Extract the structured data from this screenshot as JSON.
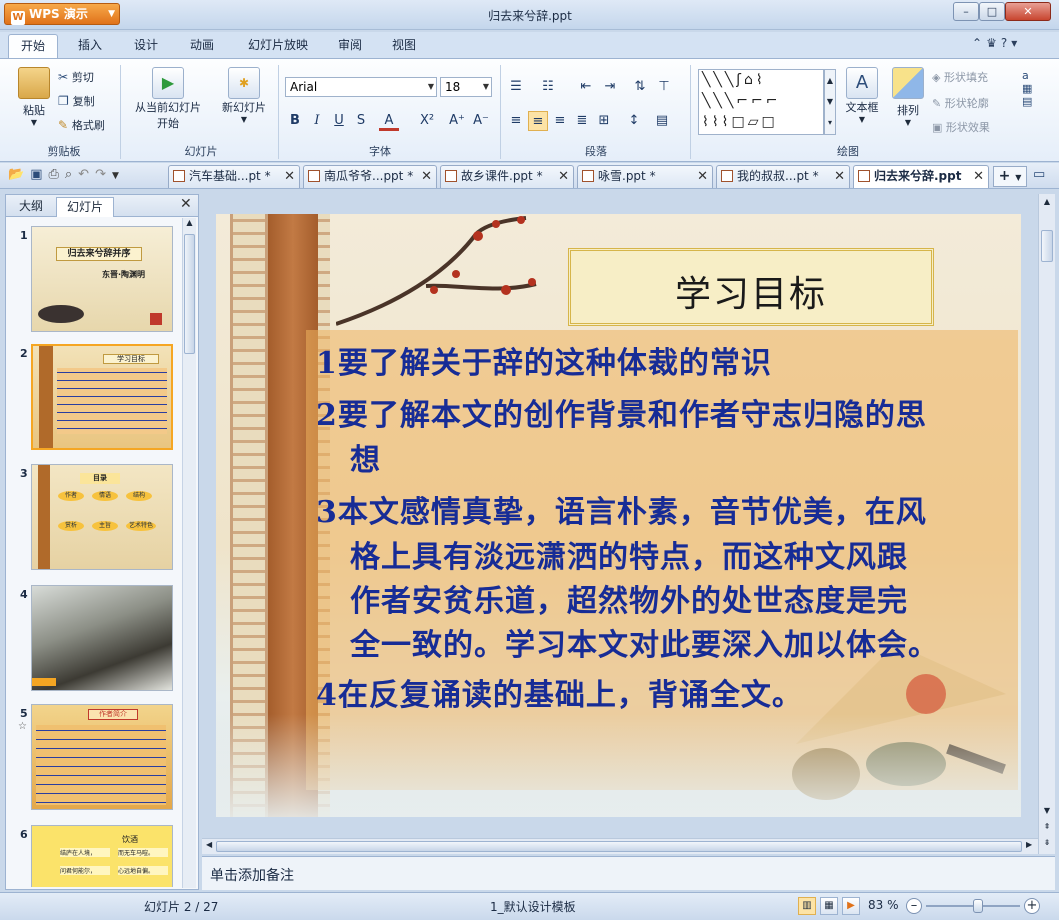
{
  "app": {
    "name": "WPS 演示",
    "window_title": "归去来兮辞.ppt"
  },
  "window_controls": {
    "minimize": "–",
    "maximize": "□",
    "close": "✕"
  },
  "menu": {
    "tabs": [
      "开始",
      "插入",
      "设计",
      "动画",
      "幻灯片放映",
      "审阅",
      "视图"
    ],
    "active": "开始"
  },
  "ribbon": {
    "clipboard": {
      "label": "剪贴板",
      "paste": "粘贴",
      "cut": "剪切",
      "copy": "复制",
      "format_painter": "格式刷"
    },
    "slides": {
      "label": "幻灯片",
      "from_current_1": "从当前幻灯片",
      "from_current_2": "开始",
      "new_slide": "新幻灯片"
    },
    "font": {
      "label": "字体",
      "font_name": "Arial",
      "font_size": "18",
      "bold": "B",
      "italic": "I",
      "underline": "U",
      "shadow": "S",
      "color": "A",
      "superscript": "X²",
      "grow": "A⁺",
      "shrink": "A⁻"
    },
    "paragraph": {
      "label": "段落"
    },
    "drawing": {
      "label": "绘图",
      "textbox": "文本框",
      "arrange": "排列",
      "shape_fill": "形状填充",
      "shape_outline": "形状轮廓",
      "shape_effect": "形状效果"
    }
  },
  "doc_tabs": [
    {
      "label": "汽车基础...pt *"
    },
    {
      "label": "南瓜爷爷...ppt *"
    },
    {
      "label": "故乡课件.ppt *"
    },
    {
      "label": "咏雪.ppt *"
    },
    {
      "label": "我的叔叔...pt *"
    },
    {
      "label": "归去来兮辞.ppt",
      "active": true
    }
  ],
  "left_pane": {
    "tabs": [
      "大纲",
      "幻灯片"
    ],
    "active": "幻灯片",
    "close": "✕",
    "thumbs": [
      {
        "num": "1",
        "title": "归去来兮辞并序",
        "sub": "东晋·陶渊明"
      },
      {
        "num": "2",
        "title": "学习目标"
      },
      {
        "num": "3",
        "title": "目录",
        "items": [
          "作者",
          "情语",
          "结构",
          "赏析",
          "主旨",
          "艺术特色"
        ]
      },
      {
        "num": "4"
      },
      {
        "num": "5",
        "title": "作者简介"
      },
      {
        "num": "6",
        "title": "饮酒",
        "lines": [
          "结庐在人境，",
          "而无车马喧。",
          "问君何能尔，",
          "心远地自偏。"
        ]
      }
    ]
  },
  "slide": {
    "title": "学习目标",
    "lines": [
      "1要了解关于辞的这种体裁的常识",
      "2要了解本文的创作背景和作者守志归隐的思",
      "想",
      "3本文感情真挚，语言朴素，音节优美，在风",
      "格上具有淡远潇洒的特点，而这种文风跟",
      "作者安贫乐道，超然物外的处世态度是完",
      "全一致的。学习本文对此要深入加以体会。",
      "4在反复诵读的基础上，背诵全文。"
    ]
  },
  "notes": {
    "placeholder": "单击添加备注"
  },
  "status": {
    "slide_pos": "幻灯片 2 / 27",
    "template": "1_默认设计模板",
    "zoom": "83 %",
    "zoom_level": 0.55
  },
  "colors": {
    "accent": "#e0721a",
    "slide_text": "#172c96"
  }
}
